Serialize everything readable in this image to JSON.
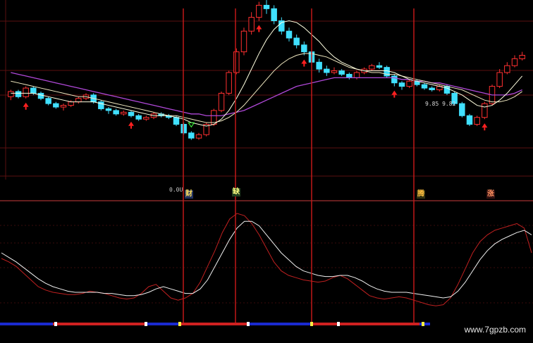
{
  "chart_data": [
    {
      "type": "candlestick",
      "panel": "price",
      "title": "",
      "grid": true,
      "price_label": "0.0U",
      "value_readout": "9.85  9.82",
      "colors": {
        "up": "#ff3030",
        "down": "#40e0ff",
        "ma_slow": "#b048d8",
        "ma_mid": "#f0e8c0",
        "ma_fast": "#ffffe0"
      },
      "y_range": [
        0,
        100
      ],
      "candles": [
        [
          46,
          49,
          44,
          50,
          43
        ],
        [
          49,
          46,
          45,
          50,
          44
        ],
        [
          46,
          51,
          45,
          52,
          44
        ],
        [
          51,
          48,
          47,
          52,
          46
        ],
        [
          48,
          45,
          44,
          49,
          43
        ],
        [
          45,
          42,
          41,
          46,
          40
        ],
        [
          42,
          40,
          39,
          43,
          38
        ],
        [
          40,
          41,
          38,
          42,
          37
        ],
        [
          41,
          43,
          40,
          44,
          39
        ],
        [
          43,
          45,
          42,
          46,
          41
        ],
        [
          45,
          47,
          44,
          48,
          43
        ],
        [
          47,
          43,
          42,
          48,
          41
        ],
        [
          43,
          39,
          38,
          44,
          37
        ],
        [
          39,
          38,
          36,
          40,
          35
        ],
        [
          38,
          36,
          35,
          39,
          34
        ],
        [
          36,
          37,
          35,
          38,
          34
        ],
        [
          37,
          35,
          34,
          38,
          33
        ],
        [
          35,
          33,
          32,
          36,
          31
        ],
        [
          33,
          34,
          32,
          35,
          31
        ],
        [
          34,
          36,
          33,
          37,
          32
        ],
        [
          36,
          35,
          34,
          37,
          33
        ],
        [
          35,
          34,
          33,
          36,
          32
        ],
        [
          34,
          30,
          29,
          35,
          28
        ],
        [
          30,
          25,
          24,
          31,
          23
        ],
        [
          25,
          22,
          21,
          26,
          20
        ],
        [
          22,
          24,
          21,
          25,
          20
        ],
        [
          24,
          30,
          23,
          31,
          22
        ],
        [
          30,
          38,
          29,
          39,
          28
        ],
        [
          38,
          48,
          37,
          49,
          36
        ],
        [
          48,
          60,
          47,
          61,
          46
        ],
        [
          60,
          72,
          59,
          74,
          58
        ],
        [
          72,
          84,
          70,
          86,
          69
        ],
        [
          84,
          92,
          82,
          95,
          80
        ],
        [
          92,
          99,
          90,
          101,
          88
        ],
        [
          99,
          97,
          94,
          102,
          93
        ],
        [
          97,
          90,
          88,
          99,
          87
        ],
        [
          90,
          84,
          82,
          92,
          80
        ],
        [
          84,
          80,
          78,
          86,
          77
        ],
        [
          80,
          76,
          74,
          82,
          73
        ],
        [
          76,
          72,
          70,
          78,
          69
        ],
        [
          72,
          66,
          65,
          74,
          64
        ],
        [
          66,
          62,
          60,
          68,
          59
        ],
        [
          62,
          60,
          58,
          64,
          57
        ],
        [
          60,
          61,
          59,
          63,
          58
        ],
        [
          61,
          59,
          58,
          62,
          57
        ],
        [
          59,
          57,
          56,
          60,
          55
        ],
        [
          57,
          60,
          56,
          61,
          55
        ],
        [
          60,
          62,
          59,
          63,
          58
        ],
        [
          62,
          64,
          61,
          65,
          60
        ],
        [
          64,
          63,
          62,
          66,
          61
        ],
        [
          63,
          58,
          57,
          64,
          56
        ],
        [
          58,
          54,
          52,
          59,
          51
        ],
        [
          54,
          52,
          50,
          55,
          49
        ],
        [
          52,
          55,
          51,
          56,
          50
        ],
        [
          55,
          53,
          52,
          56,
          51
        ],
        [
          53,
          51,
          50,
          54,
          49
        ],
        [
          51,
          50,
          49,
          52,
          48
        ],
        [
          50,
          52,
          49,
          53,
          48
        ],
        [
          52,
          48,
          47,
          53,
          46
        ],
        [
          48,
          42,
          41,
          49,
          40
        ],
        [
          42,
          35,
          34,
          43,
          33
        ],
        [
          35,
          30,
          29,
          36,
          28
        ],
        [
          30,
          34,
          29,
          35,
          28
        ],
        [
          34,
          42,
          33,
          43,
          32
        ],
        [
          42,
          52,
          41,
          53,
          40
        ],
        [
          52,
          60,
          51,
          62,
          50
        ],
        [
          60,
          64,
          59,
          66,
          58
        ],
        [
          64,
          68,
          63,
          70,
          62
        ],
        [
          68,
          70,
          67,
          72,
          66
        ]
      ],
      "ma_fast": [
        48,
        48,
        48,
        48,
        47,
        46,
        45,
        44,
        43,
        43,
        43,
        43,
        42,
        41,
        40,
        39,
        38,
        37,
        36,
        35,
        35,
        35,
        34,
        33,
        31,
        30,
        29,
        30,
        33,
        38,
        45,
        53,
        62,
        71,
        79,
        85,
        89,
        90,
        89,
        86,
        82,
        78,
        73,
        69,
        66,
        64,
        62,
        61,
        61,
        61,
        61,
        60,
        58,
        56,
        55,
        54,
        53,
        52,
        51,
        49,
        47,
        44,
        41,
        40,
        41,
        44,
        48,
        53,
        58
      ],
      "ma_mid": [
        55,
        54,
        53,
        52,
        51,
        50,
        49,
        48,
        47,
        46,
        46,
        45,
        44,
        43,
        42,
        41,
        40,
        39,
        38,
        37,
        36,
        35,
        35,
        34,
        33,
        32,
        31,
        31,
        32,
        34,
        37,
        41,
        46,
        51,
        56,
        61,
        65,
        68,
        70,
        71,
        71,
        70,
        69,
        67,
        65,
        63,
        62,
        61,
        60,
        60,
        59,
        59,
        58,
        57,
        56,
        55,
        54,
        53,
        52,
        51,
        50,
        48,
        46,
        44,
        43,
        43,
        44,
        46,
        49
      ],
      "ma_slow": [
        60,
        59,
        58,
        57,
        56,
        55,
        54,
        53,
        52,
        51,
        50,
        49,
        48,
        47,
        46,
        45,
        44,
        43,
        42,
        41,
        40,
        39,
        38,
        37,
        36,
        36,
        35,
        35,
        35,
        36,
        37,
        38,
        40,
        42,
        44,
        46,
        48,
        50,
        52,
        53,
        54,
        55,
        56,
        57,
        57,
        57,
        57,
        57,
        57,
        57,
        57,
        57,
        56,
        56,
        55,
        55,
        54,
        54,
        53,
        52,
        51,
        50,
        49,
        48,
        47,
        47,
        47,
        48,
        50
      ],
      "signals": [
        {
          "index": 2,
          "type": "buy"
        },
        {
          "index": 16,
          "type": "buy"
        },
        {
          "index": 24,
          "type": "sell"
        },
        {
          "index": 33,
          "type": "buy"
        },
        {
          "index": 39,
          "type": "buy"
        },
        {
          "index": 51,
          "type": "buy"
        },
        {
          "index": 63,
          "type": "buy"
        }
      ]
    },
    {
      "type": "line",
      "panel": "oscillator",
      "y_range": [
        0,
        100
      ],
      "grid": true,
      "series": [
        {
          "color": "#c02020",
          "values": [
            55,
            52,
            48,
            42,
            36,
            30,
            27,
            25,
            24,
            23,
            23,
            24,
            26,
            25,
            24,
            22,
            20,
            19,
            20,
            24,
            30,
            32,
            26,
            20,
            18,
            20,
            24,
            34,
            48,
            62,
            78,
            90,
            95,
            93,
            86,
            76,
            64,
            52,
            44,
            40,
            38,
            36,
            35,
            34,
            35,
            38,
            40,
            37,
            32,
            27,
            22,
            20,
            19,
            20,
            21,
            20,
            18,
            16,
            14,
            13,
            14,
            20,
            32,
            46,
            60,
            70,
            76,
            80,
            82,
            84,
            86,
            82,
            60
          ]
        },
        {
          "color": "#f0f0f0",
          "values": [
            60,
            56,
            52,
            47,
            42,
            37,
            33,
            30,
            28,
            26,
            25,
            25,
            25,
            25,
            24,
            24,
            23,
            22,
            22,
            23,
            25,
            28,
            30,
            28,
            26,
            24,
            24,
            28,
            36,
            48,
            60,
            72,
            82,
            88,
            88,
            84,
            76,
            68,
            60,
            54,
            48,
            44,
            42,
            40,
            39,
            39,
            40,
            40,
            38,
            35,
            31,
            28,
            26,
            25,
            25,
            25,
            24,
            23,
            22,
            21,
            20,
            21,
            26,
            34,
            44,
            54,
            62,
            68,
            72,
            75,
            78,
            80,
            76
          ]
        }
      ],
      "markers": [
        "财",
        "缺",
        "腾",
        "涨"
      ]
    }
  ],
  "watermark": "www.7gpzb.com"
}
